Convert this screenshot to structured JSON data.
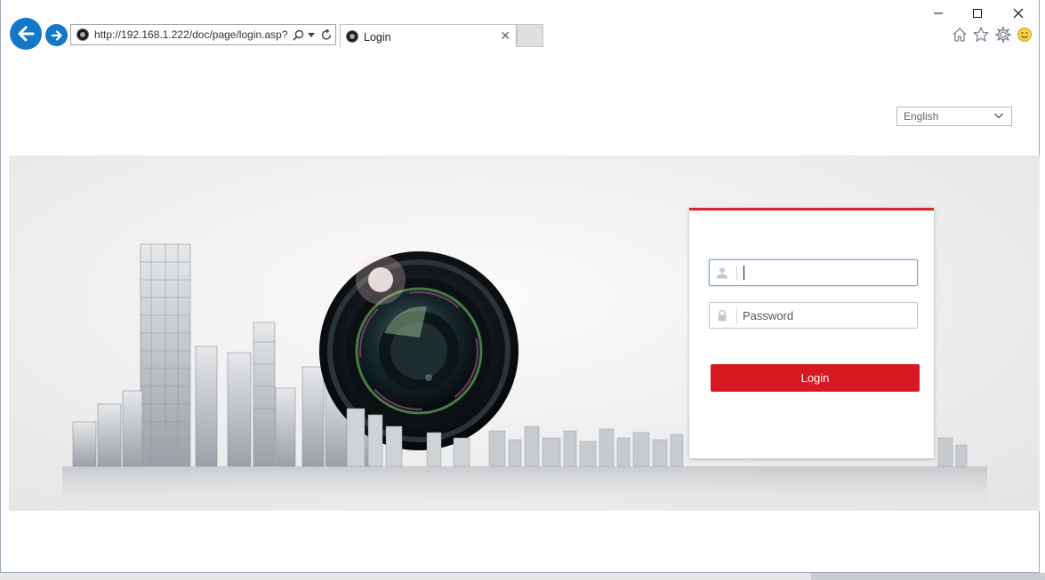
{
  "browser": {
    "url": "http://192.168.1.222/doc/page/login.asp?",
    "tab_title": "Login",
    "window_controls": [
      "minimize",
      "maximize",
      "close"
    ],
    "toolbar_icons": [
      "home-icon",
      "star-icon",
      "gear-icon",
      "smiley-icon"
    ]
  },
  "language": {
    "selected": "English"
  },
  "login": {
    "username_value": "",
    "password_placeholder": "Password",
    "button_label": "Login"
  },
  "colors": {
    "accent": "#d71a21",
    "nav_blue": "#1577c7"
  }
}
